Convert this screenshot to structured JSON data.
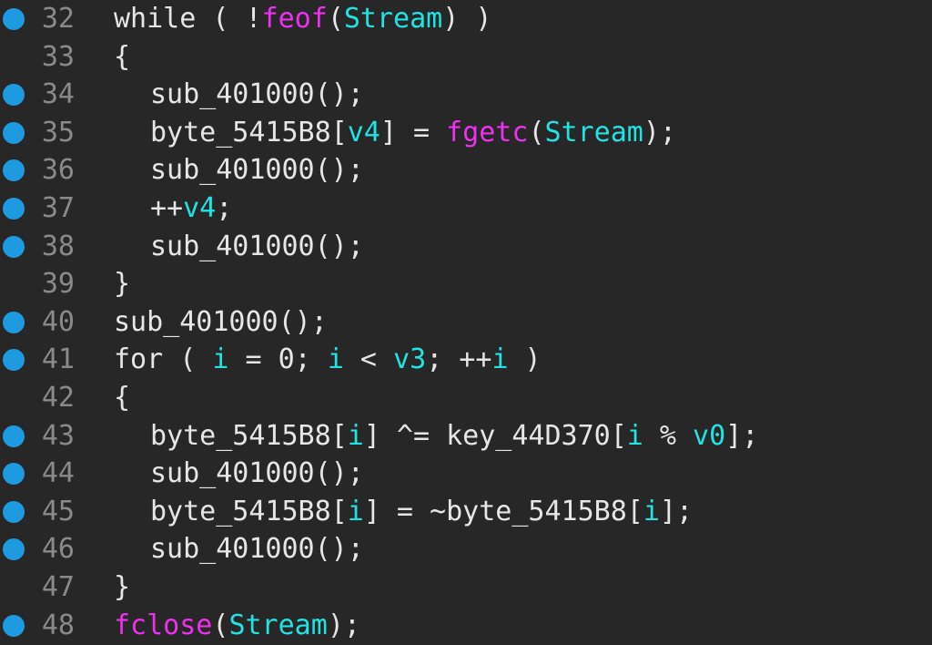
{
  "lines": [
    {
      "num": "32",
      "bp": true,
      "indent": 0,
      "tokens": [
        {
          "t": "while",
          "c": "kw"
        },
        {
          "t": " ( !",
          "c": "plain"
        },
        {
          "t": "feof",
          "c": "lib"
        },
        {
          "t": "(",
          "c": "plain"
        },
        {
          "t": "Stream",
          "c": "var"
        },
        {
          "t": ") )",
          "c": "plain"
        }
      ]
    },
    {
      "num": "33",
      "bp": false,
      "indent": 0,
      "tokens": [
        {
          "t": "{",
          "c": "plain"
        }
      ]
    },
    {
      "num": "34",
      "bp": true,
      "indent": 1,
      "tokens": [
        {
          "t": "sub_401000();",
          "c": "fn"
        }
      ]
    },
    {
      "num": "35",
      "bp": true,
      "indent": 1,
      "tokens": [
        {
          "t": "byte_5415B8[",
          "c": "plain"
        },
        {
          "t": "v4",
          "c": "var"
        },
        {
          "t": "] = ",
          "c": "plain"
        },
        {
          "t": "fgetc",
          "c": "lib"
        },
        {
          "t": "(",
          "c": "plain"
        },
        {
          "t": "Stream",
          "c": "var"
        },
        {
          "t": ");",
          "c": "plain"
        }
      ]
    },
    {
      "num": "36",
      "bp": true,
      "indent": 1,
      "tokens": [
        {
          "t": "sub_401000();",
          "c": "fn"
        }
      ]
    },
    {
      "num": "37",
      "bp": true,
      "indent": 1,
      "tokens": [
        {
          "t": "++",
          "c": "plain"
        },
        {
          "t": "v4",
          "c": "var"
        },
        {
          "t": ";",
          "c": "plain"
        }
      ]
    },
    {
      "num": "38",
      "bp": true,
      "indent": 1,
      "tokens": [
        {
          "t": "sub_401000();",
          "c": "fn"
        }
      ]
    },
    {
      "num": "39",
      "bp": false,
      "indent": 0,
      "tokens": [
        {
          "t": "}",
          "c": "plain"
        }
      ]
    },
    {
      "num": "40",
      "bp": true,
      "indent": 0,
      "tokens": [
        {
          "t": "sub_401000();",
          "c": "fn"
        }
      ]
    },
    {
      "num": "41",
      "bp": true,
      "indent": 0,
      "tokens": [
        {
          "t": "for",
          "c": "kw"
        },
        {
          "t": " ( ",
          "c": "plain"
        },
        {
          "t": "i",
          "c": "var"
        },
        {
          "t": " = 0; ",
          "c": "plain"
        },
        {
          "t": "i",
          "c": "var"
        },
        {
          "t": " < ",
          "c": "plain"
        },
        {
          "t": "v3",
          "c": "var"
        },
        {
          "t": "; ++",
          "c": "plain"
        },
        {
          "t": "i",
          "c": "var"
        },
        {
          "t": " )",
          "c": "plain"
        }
      ]
    },
    {
      "num": "42",
      "bp": false,
      "indent": 0,
      "tokens": [
        {
          "t": "{",
          "c": "plain"
        }
      ]
    },
    {
      "num": "43",
      "bp": true,
      "indent": 1,
      "tokens": [
        {
          "t": "byte_5415B8[",
          "c": "plain"
        },
        {
          "t": "i",
          "c": "var"
        },
        {
          "t": "] ^= key_44D370[",
          "c": "plain"
        },
        {
          "t": "i",
          "c": "var"
        },
        {
          "t": " % ",
          "c": "plain"
        },
        {
          "t": "v0",
          "c": "var"
        },
        {
          "t": "];",
          "c": "plain"
        }
      ]
    },
    {
      "num": "44",
      "bp": true,
      "indent": 1,
      "tokens": [
        {
          "t": "sub_401000();",
          "c": "fn"
        }
      ]
    },
    {
      "num": "45",
      "bp": true,
      "indent": 1,
      "tokens": [
        {
          "t": "byte_5415B8[",
          "c": "plain"
        },
        {
          "t": "i",
          "c": "var"
        },
        {
          "t": "] = ~byte_5415B8[",
          "c": "plain"
        },
        {
          "t": "i",
          "c": "var"
        },
        {
          "t": "];",
          "c": "plain"
        }
      ]
    },
    {
      "num": "46",
      "bp": true,
      "indent": 1,
      "tokens": [
        {
          "t": "sub_401000();",
          "c": "fn"
        }
      ]
    },
    {
      "num": "47",
      "bp": false,
      "indent": 0,
      "tokens": [
        {
          "t": "}",
          "c": "plain"
        }
      ]
    },
    {
      "num": "48",
      "bp": true,
      "indent": 0,
      "tokens": [
        {
          "t": "fclose",
          "c": "lib"
        },
        {
          "t": "(",
          "c": "plain"
        },
        {
          "t": "Stream",
          "c": "var"
        },
        {
          "t": ");",
          "c": "plain"
        }
      ]
    }
  ],
  "colors": {
    "background": "#272727",
    "line_number": "#8a8a8a",
    "breakpoint": "#1e9ae0",
    "plain": "#e6e6e6",
    "library_call": "#f030f0",
    "variable": "#22e3e3"
  }
}
